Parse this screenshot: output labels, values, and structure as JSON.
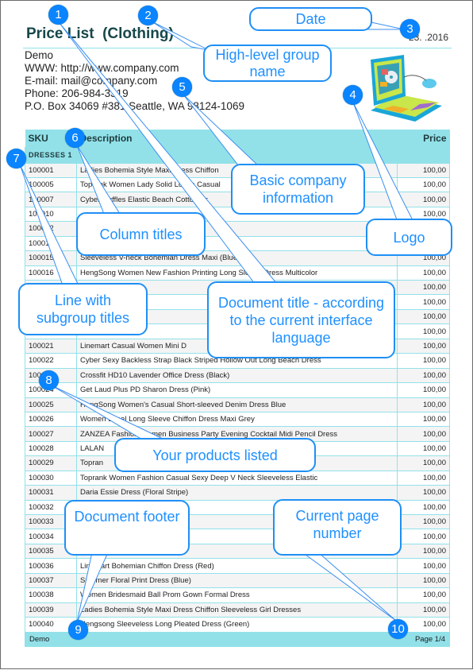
{
  "document": {
    "title": "Price List  (Clothing)",
    "date": "23.  .2016",
    "company": [
      "Demo",
      "WWW: http://www.company.com",
      "E-mail: mail@company.com",
      "Phone: 206-984-3319",
      "P.O. Box 34069 #381 Seattle, WA 98124-1069"
    ],
    "logo_icon": "laptop-logo-icon",
    "columns": {
      "sku": "SKU",
      "description": "Description",
      "price": "Price"
    },
    "group": "DRESSES 1",
    "rows": [
      [
        "100001",
        "Ladies Bohemia Style Maxi Dress Chiffon",
        "100,00"
      ],
      [
        "100005",
        "Toprank Women Lady Solid Loose Casual",
        "100,00"
      ],
      [
        "100007",
        "Cyber Ruffles Elastic Beach Cotton Dr",
        "100,00"
      ],
      [
        "100010",
        "",
        "100,00"
      ],
      [
        "100012",
        "",
        "100,00"
      ],
      [
        "100014",
        "",
        "100,00"
      ],
      [
        "100015",
        "Sleeveless V-neck Bohemian Dress Maxi (Blue)",
        "100,00"
      ],
      [
        "100016",
        "HengSong Women New Fashion Printing Long Sleeve Dress Multicolor",
        "100,00"
      ],
      [
        "100017",
        "",
        "100,00"
      ],
      [
        "100018",
        "",
        "100,00"
      ],
      [
        "100019",
        "",
        "100,00"
      ],
      [
        "100020",
        "",
        "100,00"
      ],
      [
        "100021",
        "Linemart Casual Women Mini D",
        "100,00"
      ],
      [
        "100022",
        "Cyber Sexy Backless Strap Black Striped Hollow Out Long Beach Dress",
        "100,00"
      ],
      [
        "100023",
        "Crossfit HD10 Lavender Office Dress (Black)",
        "100,00"
      ],
      [
        "100024",
        "Get Laud Plus PD Sharon Dress (Pink)",
        "100,00"
      ],
      [
        "100025",
        "HangSong Women's Casual Short-sleeved Denim Dress Blue",
        "100,00"
      ],
      [
        "100026",
        "Women Lapel Long Sleeve Chiffon Dress Maxi Grey",
        "100,00"
      ],
      [
        "100027",
        "ZANZEA Fashion Women Business Party Evening Cocktail Midi Pencil Dress",
        "100,00"
      ],
      [
        "100028",
        "LALAN",
        "100,00"
      ],
      [
        "100029",
        "Topran",
        "100,00"
      ],
      [
        "100030",
        "Toprank Women Fashion Casual Sexy Deep V Neck Sleeveless Elastic",
        "100,00"
      ],
      [
        "100031",
        "Daria Essie Dress (Floral Stripe)",
        "100,00"
      ],
      [
        "100032",
        "",
        "100,00"
      ],
      [
        "100033",
        "",
        "100,00"
      ],
      [
        "100034",
        "",
        "100,00"
      ],
      [
        "100035",
        "",
        "100,00"
      ],
      [
        "100036",
        "Linemart Bohemian Chiffon Dress (Red)",
        "100,00"
      ],
      [
        "100037",
        "Summer Floral Print Dress (Blue)",
        "100,00"
      ],
      [
        "100038",
        "Women Bridesmaid Ball Prom Gown Formal Dress",
        "100,00"
      ],
      [
        "100039",
        "Ladies Bohemia Style Maxi Dress Chiffon Sleeveless Girl Dresses",
        "100,00"
      ],
      [
        "100040",
        "Hengsong Sleeveless Long Pleated Dress (Green)",
        "100,00"
      ]
    ],
    "footer": {
      "left": "Demo",
      "page": "Page 1/4"
    }
  },
  "callouts": [
    {
      "num": "1",
      "text": "Document title - according to the current interface language"
    },
    {
      "num": "2",
      "text": "High-level group name"
    },
    {
      "num": "3",
      "text": "Date"
    },
    {
      "num": "4",
      "text": "Logo"
    },
    {
      "num": "5",
      "text": "Basic company information"
    },
    {
      "num": "6",
      "text": "Column titles"
    },
    {
      "num": "7",
      "text": "Line with subgroup titles"
    },
    {
      "num": "8",
      "text": "Your products listed"
    },
    {
      "num": "9",
      "text": "Document footer"
    },
    {
      "num": "10",
      "text": "Current page number"
    }
  ],
  "colors": {
    "accent": "#92e1e9",
    "callout": "#1e90ff",
    "marker": "#0a84ff"
  }
}
